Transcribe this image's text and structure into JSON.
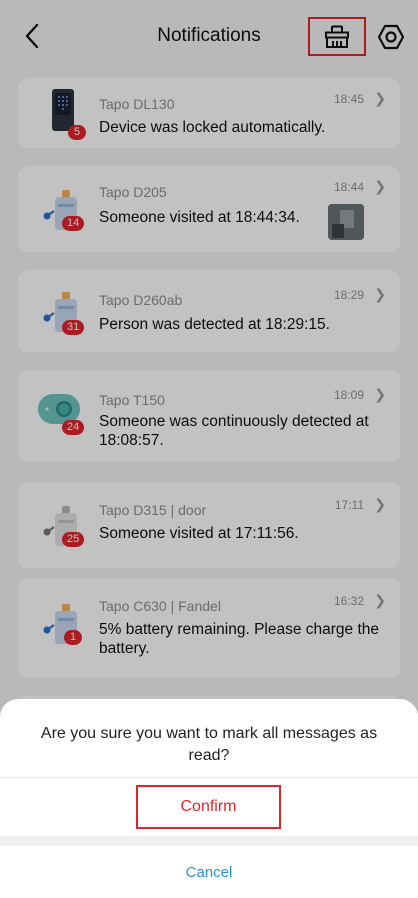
{
  "header": {
    "title": "Notifications",
    "back_icon": "chevron-left-icon",
    "clear_icon": "broom-icon",
    "settings_icon": "hexagon-gear-icon"
  },
  "notifications": [
    {
      "device": "Tapo DL130",
      "time": "18:45",
      "message": "Device was locked automatically.",
      "badge": "5",
      "icon": "smart-lock-icon"
    },
    {
      "device": "Tapo D205",
      "time": "18:44",
      "message": "Someone visited at 18:44:34.",
      "badge": "14",
      "icon": "battery-doorbell-icon",
      "thumbnail": "snapshot-thumbnail"
    },
    {
      "device": "Tapo D260ab",
      "time": "18:29",
      "message": "Person was detected at 18:29:15.",
      "badge": "31",
      "icon": "battery-doorbell-icon"
    },
    {
      "device": "Tapo T150",
      "time": "18:09",
      "message": "Someone was continuously detected at 18:08:57.",
      "badge": "24",
      "icon": "motion-sensor-icon"
    },
    {
      "device": "Tapo D315 | door",
      "time": "17:11",
      "message": "Someone visited at 17:11:56.",
      "badge": "25",
      "icon": "battery-doorbell-icon"
    },
    {
      "device": "Tapo C630 | Fandel",
      "time": "16:32",
      "message": "5% battery remaining. Please charge the battery.",
      "badge": "1",
      "icon": "battery-doorbell-icon"
    }
  ],
  "dialog": {
    "prompt": "Are you sure you want to mark all messages as read?",
    "confirm_label": "Confirm",
    "cancel_label": "Cancel"
  },
  "colors": {
    "accent_red": "#e0262d",
    "cancel_blue": "#2b8fd0"
  }
}
